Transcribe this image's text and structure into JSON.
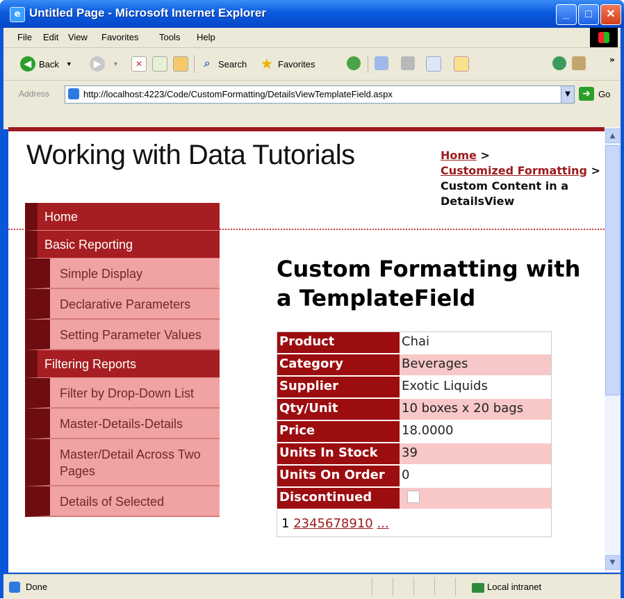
{
  "window": {
    "title": "Untitled Page - Microsoft Internet Explorer",
    "minimize": "_",
    "maximize": "□",
    "close": "✕"
  },
  "menu": [
    "File",
    "Edit",
    "View",
    "Favorites",
    "Tools",
    "Help"
  ],
  "toolbar": {
    "back": "Back",
    "search": "Search",
    "favorites": "Favorites",
    "overflow": "»"
  },
  "address": {
    "label": "Address",
    "url": "http://localhost:4223/Code/CustomFormatting/DetailsViewTemplateField.aspx",
    "go": "Go"
  },
  "site": {
    "title": "Working with Data Tutorials"
  },
  "breadcrumb": {
    "home": "Home",
    "sep1": " >",
    "section": "Customized Formatting",
    "sep2": " >",
    "current": "Custom Content in a DetailsView"
  },
  "nav": {
    "home": "Home",
    "basic": "Basic Reporting",
    "simple": "Simple Display",
    "declarative": "Declarative Parameters",
    "setting": "Setting Parameter Values",
    "filtering": "Filtering Reports",
    "dropdown": "Filter by Drop-Down List",
    "master": "Master-Details-Details",
    "across": "Master/Detail Across Two Pages",
    "selected": "Details of Selected"
  },
  "main": {
    "heading": "Custom Formatting with a TemplateField"
  },
  "details": [
    {
      "label": "Product",
      "value": "Chai"
    },
    {
      "label": "Category",
      "value": "Beverages"
    },
    {
      "label": "Supplier",
      "value": "Exotic Liquids"
    },
    {
      "label": "Qty/Unit",
      "value": "10 boxes x 20 bags"
    },
    {
      "label": "Price",
      "value": "18.0000"
    },
    {
      "label": "Units In Stock",
      "value": "39"
    },
    {
      "label": "Units On Order",
      "value": "0"
    },
    {
      "label": "Discontinued",
      "value": ""
    }
  ],
  "pager": {
    "current": "1",
    "pages": [
      "2",
      "3",
      "4",
      "5",
      "6",
      "7",
      "8",
      "9",
      "10",
      "..."
    ]
  },
  "status": {
    "text": "Done",
    "zone": "Local intranet"
  }
}
